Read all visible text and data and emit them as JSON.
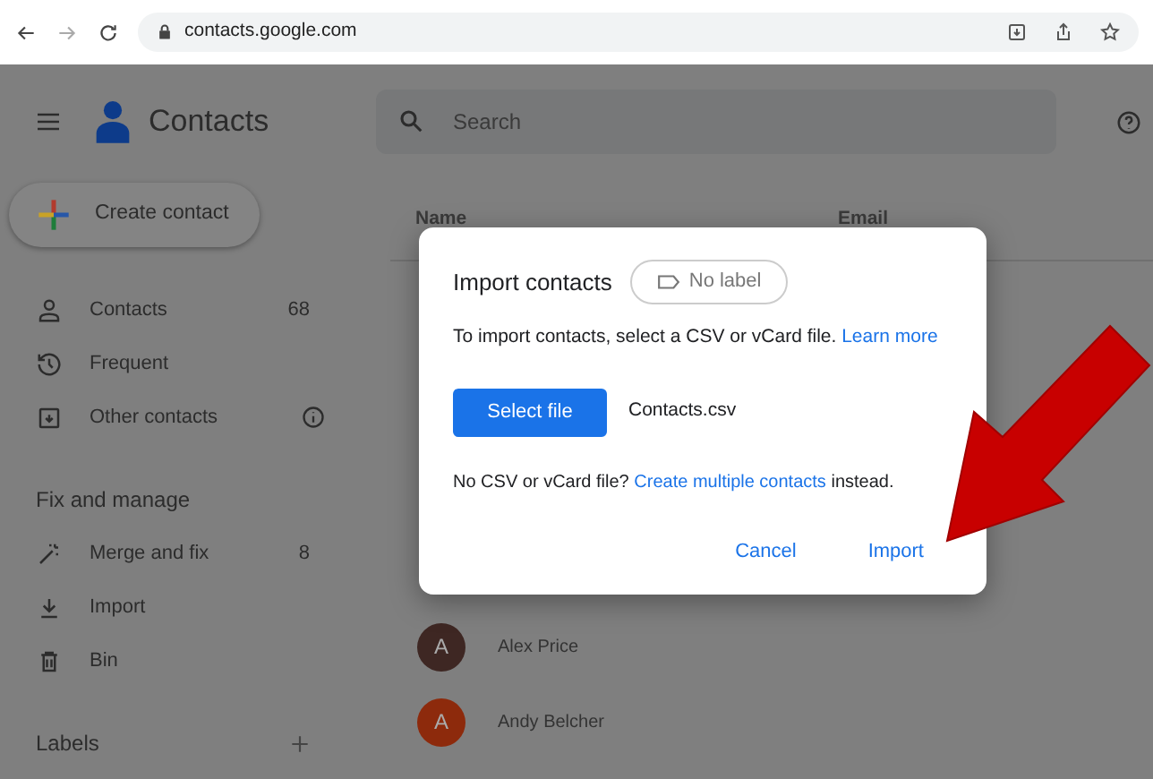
{
  "browser": {
    "url": "contacts.google.com"
  },
  "app": {
    "title": "Contacts",
    "search": {
      "placeholder": "Search"
    },
    "create_button": "Create contact"
  },
  "sidebar": {
    "items": [
      {
        "label": "Contacts",
        "count": "68",
        "selected": false
      },
      {
        "label": "Frequent",
        "selected": false
      },
      {
        "label": "Other contacts",
        "info": true,
        "selected": false
      }
    ],
    "fix_section": {
      "heading": "Fix and manage",
      "items": [
        {
          "label": "Merge and fix",
          "count": "8",
          "selected": false
        },
        {
          "label": "Import",
          "selected": false
        },
        {
          "label": "Bin",
          "selected": false
        }
      ]
    },
    "labels_heading": "Labels"
  },
  "table": {
    "columns": [
      "Name",
      "Email"
    ],
    "rows": [
      {
        "avatar": "A",
        "name": "Alex Price",
        "color": "#3e2723"
      },
      {
        "avatar": "A",
        "name": "Andy Belcher",
        "color": "#8d2a0c"
      }
    ]
  },
  "dialog": {
    "title": "Import contacts",
    "label_chip": "No label",
    "text": "To import contacts, select a CSV or vCard file.",
    "learn_more": "Learn more",
    "select_button": "Select file",
    "file_name": "Contacts.csv",
    "hint_before": "No CSV or vCard file?",
    "hint_link": "Create multiple contacts",
    "hint_after": "instead.",
    "buttons": [
      "Cancel",
      "Import"
    ]
  }
}
